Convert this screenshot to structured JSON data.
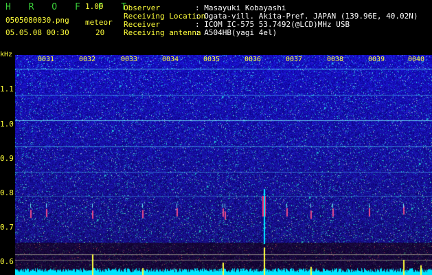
{
  "header": {
    "app_title": "H R O F F T",
    "version": "1.00",
    "filename": "0505080030.png",
    "date_time": "05.05.08 00:30",
    "meteor_label": "meteor",
    "meteor_count": "20"
  },
  "info": [
    {
      "label": "Observer",
      "value": ": Masayuki Kobayashi"
    },
    {
      "label": "Receiving Location",
      "value": ": Ogata-vill. Akita-Pref. JAPAN (139.96E, 40.02N)"
    },
    {
      "label": "Receiver",
      "value": ": ICOM IC-575 53.7492(@LCD)MHz USB"
    },
    {
      "label": "Receiving antenna",
      "value": ": A504HB(yagi 4el)"
    }
  ],
  "axis": {
    "unit": "kHz",
    "freq_labels": [
      "1.1",
      "1.0",
      "0.9",
      "0.8",
      "0.7",
      "0.6"
    ],
    "minute_labels": [
      "0031",
      "0032",
      "0033",
      "0034",
      "0035",
      "0036",
      "0037",
      "0038",
      "0039",
      "0040"
    ]
  },
  "colors": {
    "background": "#000000",
    "label_yellow": "#ffff3a",
    "title_green": "#3ad13a",
    "spectrum_blue": "#1a1a9a",
    "trace_cyan": "#00e5ff",
    "meteor_red": "#ff2a6a"
  }
}
